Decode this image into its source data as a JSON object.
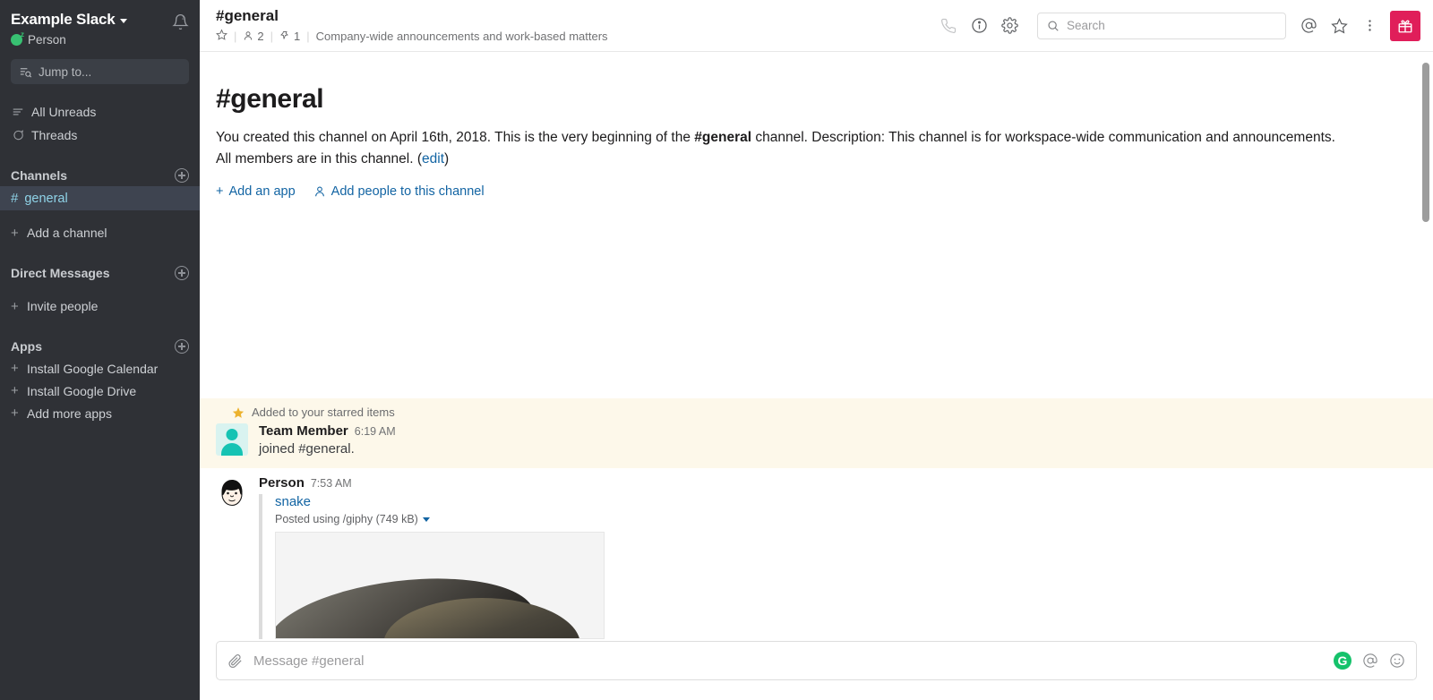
{
  "sidebar": {
    "workspace_name": "Example Slack",
    "workspace_caret_icon": "chevron-down-icon",
    "notifications_icon": "bell-snooze-icon",
    "user_name": "Person",
    "user_status_icon": "status-snooze-dot",
    "jump_to": {
      "label": "Jump to...",
      "icon": "jump-to-icon"
    },
    "nav": [
      {
        "label": "All Unreads",
        "icon": "unreads-lines-icon"
      },
      {
        "label": "Threads",
        "icon": "threads-bubble-icon"
      }
    ],
    "channels_section": {
      "label": "Channels",
      "add_icon": "plus-circle-icon"
    },
    "channels": [
      {
        "prefix": "#",
        "name": "general",
        "active": true
      }
    ],
    "add_channel": {
      "label": "Add a channel",
      "prefix": "+"
    },
    "dm_section": {
      "label": "Direct Messages",
      "add_icon": "plus-circle-icon"
    },
    "invite_people": {
      "label": "Invite people",
      "prefix": "+"
    },
    "apps_section": {
      "label": "Apps",
      "add_icon": "plus-circle-icon"
    },
    "apps": [
      {
        "label": "Install Google Calendar",
        "prefix": "+"
      },
      {
        "label": "Install Google Drive",
        "prefix": "+"
      },
      {
        "label": "Add more apps",
        "prefix": "+"
      }
    ]
  },
  "channel_header": {
    "title": "#general",
    "star_icon": "star-outline-icon",
    "members_icon": "person-icon",
    "members_count": "2",
    "pins_icon": "pin-icon",
    "pins_count": "1",
    "topic": "Company-wide announcements and work-based matters",
    "call_icon": "phone-icon",
    "info_icon": "info-circle-icon",
    "settings_icon": "gear-icon",
    "search": {
      "placeholder": "Search",
      "icon": "search-icon",
      "value": ""
    },
    "mentions_icon": "at-icon",
    "starred_icon": "star-outline-icon",
    "more_icon": "kebab-menu-icon",
    "gift_icon": "gift-icon",
    "gift_color": "#e01e5a"
  },
  "intro": {
    "heading": "#general",
    "text_1": "You created this channel on April 16th, 2018. This is the very beginning of the ",
    "channel_bold_1": "#general",
    "text_2": " channel. Description: This channel is for workspace-wide communication and announcements. All members are in this channel. (",
    "edit_link": "edit",
    "text_3": ")",
    "add_app": {
      "label": "Add an app",
      "prefix": "+"
    },
    "add_people": {
      "label": "Add people to this channel",
      "icon": "person-add-icon"
    }
  },
  "messages": {
    "starred_banner": {
      "label": "Added to your starred items",
      "icon": "star-filled-icon"
    },
    "items": [
      {
        "author": "Team Member",
        "time": "6:19 AM",
        "text": "joined #general.",
        "avatar": "teal-person-avatar",
        "starred": true
      },
      {
        "author": "Person",
        "time": "7:53 AM",
        "avatar": "cartoon-face-avatar",
        "starred": false,
        "attachment": {
          "title": "snake",
          "subtitle": "Posted using /giphy (749 kB)",
          "caret_icon": "caret-down-icon",
          "image_alt": "snake-image"
        }
      }
    ]
  },
  "composer": {
    "placeholder": "Message #general",
    "attach_icon": "paperclip-icon",
    "grammarly_icon": "G",
    "mention_icon": "at-icon",
    "emoji_icon": "smiley-icon"
  },
  "colors": {
    "sidebar_bg": "#2f3136",
    "active_channel_bg": "#3e4450",
    "active_channel_text": "#8fd3e8",
    "link_blue": "#1264a3",
    "starred_bg": "#fdf8ea",
    "gift_pink": "#e01e5a",
    "grammarly_green": "#15c26b"
  }
}
